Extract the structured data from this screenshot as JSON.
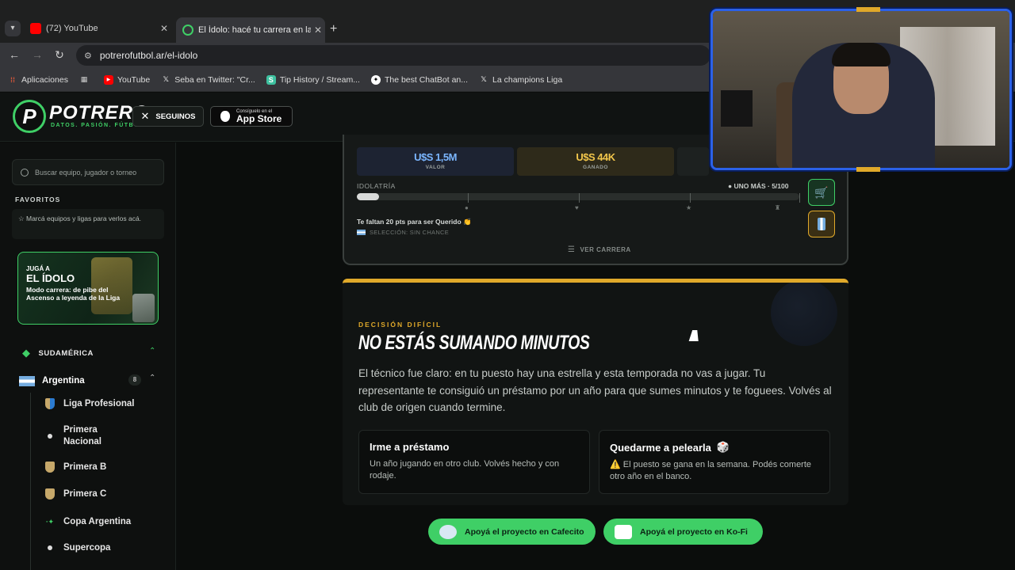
{
  "browser": {
    "tabs": [
      {
        "title": "(72) YouTube",
        "favicon": "youtube-icon",
        "active": false
      },
      {
        "title": "El Ídolo: hacé tu carrera en la Li",
        "favicon": "potrero-favicon",
        "active": true
      }
    ],
    "url": "potrerofutbol.ar/el-idolo",
    "bookmarks": [
      {
        "label": "Aplicaciones",
        "icon": "apps-grid-icon"
      },
      {
        "label": "",
        "icon": "tab-groups-icon"
      },
      {
        "label": "YouTube",
        "icon": "youtube-icon"
      },
      {
        "label": "Seba en Twitter: \"Cr...",
        "icon": "x-icon"
      },
      {
        "label": "Tip History / Stream...",
        "icon": "streamelements-icon"
      },
      {
        "label": "The best ChatBot an...",
        "icon": "chatbot-icon"
      },
      {
        "label": "La champions Liga",
        "icon": "x-icon"
      }
    ]
  },
  "header": {
    "logo_letter": "P",
    "logo_text": "POTRERO",
    "tagline": "DATOS. PASIÓN. FÚTBOL.",
    "follow_label": "SEGUINOS",
    "appstore_small": "Consíguelo en el",
    "appstore_big": "App Store"
  },
  "sidebar": {
    "search_placeholder": "Buscar equipo, jugador o torneo",
    "favorites_heading": "FAVORITOS",
    "favorites_hint": "Marcá equipos y ligas para verlos acá.",
    "promo": {
      "line1": "JUGÁ A",
      "line2": "EL ÍDOLO",
      "line3": "Modo carrera: de pibe del Ascenso a leyenda de la Liga"
    },
    "region": "SUDAMÉRICA",
    "country": {
      "name": "Argentina",
      "count": "8"
    },
    "leagues": [
      "Liga Profesional",
      "Primera Nacional",
      "Primera B",
      "Primera C",
      "Copa Argentina",
      "Supercopa"
    ]
  },
  "career": {
    "stats": [
      {
        "value": "U$S 1,5M",
        "label": "VALOR",
        "color": "#7bb6ff"
      },
      {
        "value": "U$S 44K",
        "label": "GANADO",
        "color": "#f2c64b"
      }
    ],
    "idolatry_label": "IDOLATRÍA",
    "idolatry_value": "UNO MÁS · 5/100",
    "idolatry_progress": 0.05,
    "need_text": "Te faltan 20 pts para ser Querido 👏",
    "national_team": "SELECCIÓN: SIN CHANCE",
    "view_career": "VER CARRERA"
  },
  "decision": {
    "tag": "DECISIÓN DIFÍCIL",
    "title": "NO ESTÁS SUMANDO MINUTOS",
    "body": "El técnico fue claro: en tu puesto hay una estrella y esta temporada no vas a jugar. Tu representante te consiguió un préstamo por un año para que sumes minutos y te foguees. Volvés al club de origen cuando termine.",
    "options": [
      {
        "title": "Irme a préstamo",
        "desc": "Un año jugando en otro club. Volvés hecho y con rodaje.",
        "emoji": ""
      },
      {
        "title": "Quedarme a pelearla",
        "desc": "El puesto se gana en la semana. Podés comerte otro año en el banco.",
        "emoji": "🎲",
        "warn": "⚠️"
      }
    ]
  },
  "support": {
    "cafecito": "Apoyá el proyecto en Cafecito",
    "kofi": "Apoyá el proyecto en Ko-Fi"
  },
  "colors": {
    "accent": "#3fcf66",
    "gold": "#e0a92a",
    "bg": "#0b0d0c"
  }
}
